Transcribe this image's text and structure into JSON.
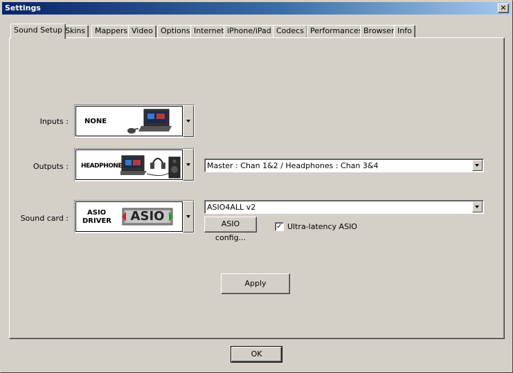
{
  "window": {
    "title": "Settings",
    "close_glyph": "✕"
  },
  "tabs": [
    {
      "label": "Sound Setup",
      "active": true
    },
    {
      "label": "Skins"
    },
    {
      "label": "Mappers"
    },
    {
      "label": "Video"
    },
    {
      "label": "Options"
    },
    {
      "label": "Internet"
    },
    {
      "label": "iPhone/iPad"
    },
    {
      "label": "Codecs"
    },
    {
      "label": "Performances"
    },
    {
      "label": "Browser"
    },
    {
      "label": "Info"
    }
  ],
  "inputs": {
    "label": "Inputs :",
    "value": "NONE",
    "icon": "laptop-mouse-icon"
  },
  "outputs": {
    "label": "Outputs :",
    "value": "HEADPHONES",
    "icon": "laptop-headphones-speaker-icon",
    "routing": "Master : Chan 1&2 / Headphones : Chan 3&4"
  },
  "soundcard": {
    "label": "Sound card :",
    "value_line1": "ASIO",
    "value_line2": "DRIVER",
    "logo_text": "ASIO",
    "driver": "ASIO4ALL v2",
    "config_button": "ASIO config...",
    "ultra_latency_label": "Ultra-latency ASIO",
    "ultra_latency_checked": true
  },
  "apply_button": "Apply",
  "ok_button": "OK"
}
